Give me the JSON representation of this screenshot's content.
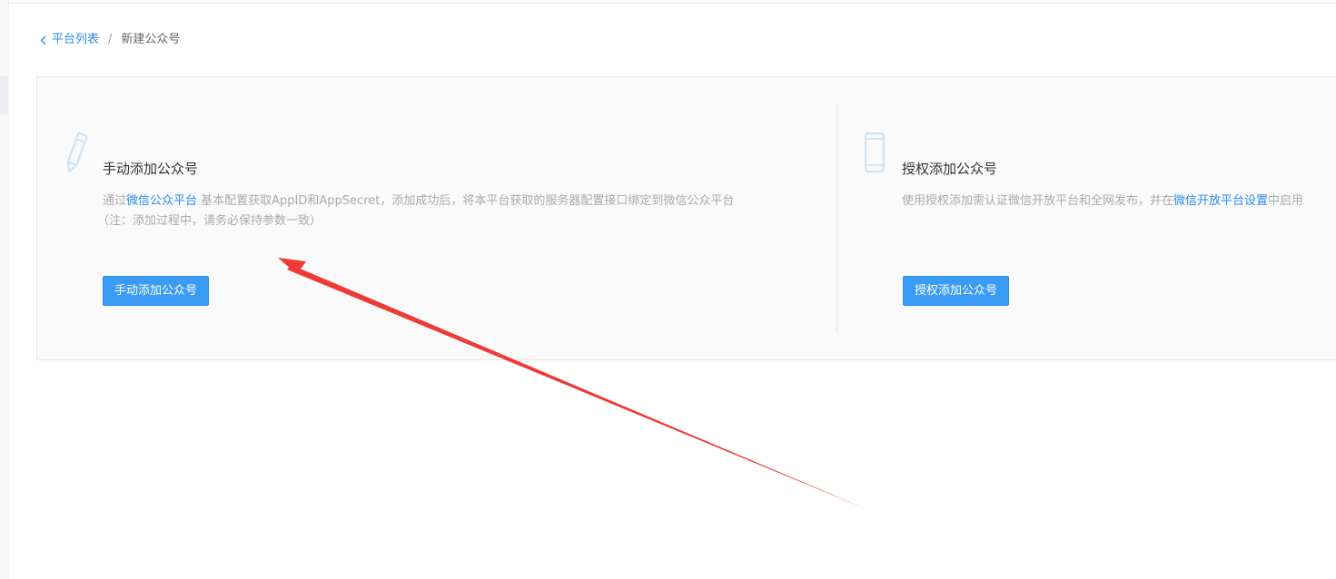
{
  "breadcrumb": {
    "back_label": "平台列表",
    "separator": "/",
    "current": "新建公众号"
  },
  "manual_card": {
    "icon": "pencil-icon",
    "title": "手动添加公众号",
    "desc_prefix": "通过",
    "desc_link": "微信公众平台",
    "desc_suffix": " 基本配置获取AppID和AppSecret，添加成功后，将本平台获取的服务器配置接口绑定到微信公众平台",
    "desc_note": "（注：添加过程中，请务必保持参数一致）",
    "button_label": "手动添加公众号"
  },
  "auth_card": {
    "icon": "phone-icon",
    "title": "授权添加公众号",
    "desc_prefix": "使用授权添加需认证微信开放平台和全网发布，并在",
    "desc_link": "微信开放平台设置",
    "desc_suffix": "中启用",
    "button_label": "授权添加公众号"
  },
  "colors": {
    "primary": "#2d8cf0",
    "button_bg": "#3a9bf5",
    "annotation_arrow": "#ee3a36",
    "icon_tint": "#cfe3f6"
  }
}
